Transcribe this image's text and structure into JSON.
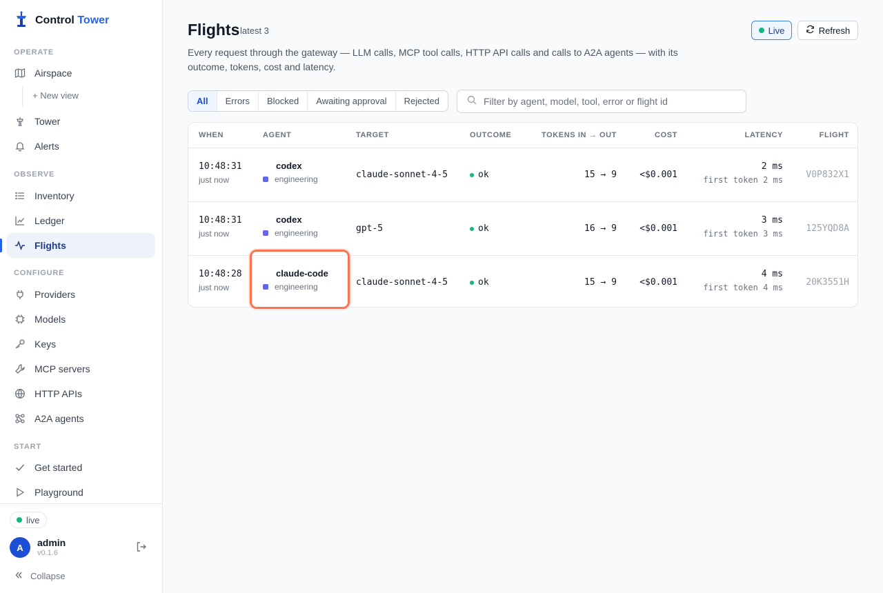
{
  "brand": {
    "name": "Control",
    "accent": "Tower"
  },
  "sidebar": {
    "sections": {
      "operate": "OPERATE",
      "observe": "OBSERVE",
      "configure": "CONFIGURE",
      "start": "START"
    },
    "items": {
      "airspace": "Airspace",
      "new_view": "+ New view",
      "tower": "Tower",
      "alerts": "Alerts",
      "inventory": "Inventory",
      "ledger": "Ledger",
      "flights": "Flights",
      "providers": "Providers",
      "models": "Models",
      "keys": "Keys",
      "mcp_servers": "MCP servers",
      "http_apis": "HTTP APIs",
      "a2a_agents": "A2A agents",
      "get_started": "Get started",
      "playground": "Playground"
    },
    "active_item": "Flights",
    "footer": {
      "status": "live",
      "avatar_initial": "A",
      "user": "admin",
      "version": "v0.1.6",
      "collapse": "Collapse"
    }
  },
  "header": {
    "title": "Flights",
    "subtitle": "latest 3",
    "description": "Every request through the gateway — LLM calls, MCP tool calls, HTTP API calls and calls to A2A agents — with its outcome, tokens, cost and latency.",
    "live_button": "Live",
    "refresh_button": "Refresh"
  },
  "filters": {
    "tabs": [
      "All",
      "Errors",
      "Blocked",
      "Awaiting approval",
      "Rejected"
    ],
    "active": "All",
    "search_placeholder": "Filter by agent, model, tool, error or flight id"
  },
  "table": {
    "columns": [
      "WHEN",
      "AGENT",
      "TARGET",
      "OUTCOME",
      "TOKENS IN → OUT",
      "COST",
      "LATENCY",
      "FLIGHT"
    ],
    "rows": [
      {
        "time": "10:48:31",
        "relative": "just now",
        "agent": "codex",
        "team": "engineering",
        "target": "claude-sonnet-4-5",
        "outcome": "ok",
        "tokens": "15 → 9",
        "cost": "<$0.001",
        "latency": "2 ms",
        "first_token": "first token 2 ms",
        "flight": "V0P832X1"
      },
      {
        "time": "10:48:31",
        "relative": "just now",
        "agent": "codex",
        "team": "engineering",
        "target": "gpt-5",
        "outcome": "ok",
        "tokens": "16 → 9",
        "cost": "<$0.001",
        "latency": "3 ms",
        "first_token": "first token 3 ms",
        "flight": "125YQD8A"
      },
      {
        "time": "10:48:28",
        "relative": "just now",
        "agent": "claude-code",
        "team": "engineering",
        "target": "claude-sonnet-4-5",
        "outcome": "ok",
        "tokens": "15 → 9",
        "cost": "<$0.001",
        "latency": "4 ms",
        "first_token": "first token 4 ms",
        "flight": "20K3551H"
      }
    ]
  },
  "colors": {
    "accent": "#2563eb",
    "ok": "#10b981",
    "team": "#6366f1",
    "highlight": "#f97350"
  }
}
